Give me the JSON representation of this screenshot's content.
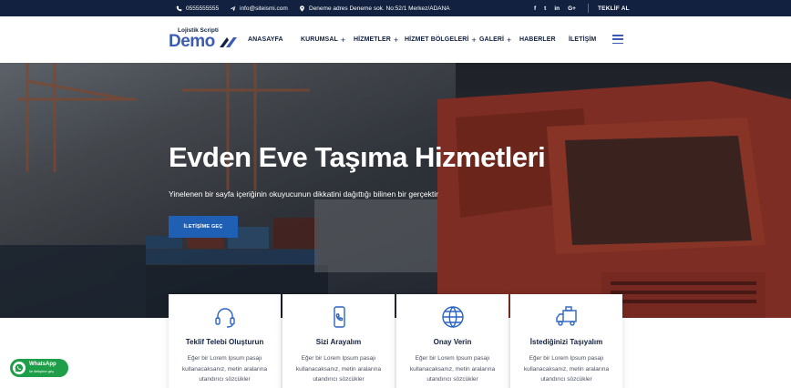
{
  "topbar": {
    "phone": "0555555555",
    "email": "info@siteismi.com",
    "address": "Deneme adres Deneme sok. No:52/1 Merkez/ADANA",
    "social": [
      "f",
      "t",
      "in",
      "G+"
    ],
    "quote_label": "TEKLİF AL"
  },
  "header": {
    "logo_sub": "Lojistik Scripti",
    "logo_main": "Demo",
    "nav": [
      {
        "label": "ANASAYFA",
        "has_children": false
      },
      {
        "label": "KURUMSAL",
        "has_children": true
      },
      {
        "label": "HİZMETLER",
        "has_children": true
      },
      {
        "label": "HİZMET BÖLGELERİ",
        "has_children": true
      },
      {
        "label": "GALERİ",
        "has_children": true
      },
      {
        "label": "HABERLER",
        "has_children": false
      },
      {
        "label": "İLETİŞİM",
        "has_children": false
      }
    ],
    "plus_symbol": "+"
  },
  "hero": {
    "title": "Evden Eve Taşıma Hizmetleri",
    "subtitle": "Yinelenen bir sayfa içeriğinin okuyucunun dikkatini dağıttığı bilinen bir gerçektir",
    "button_label": "İLETİŞİME GEÇ"
  },
  "cards": [
    {
      "icon": "headset-icon",
      "title": "Teklif Telebi Oluşturun",
      "text": "Eğer bir Lorem Ipsum pasajı kullanacaksanız, metin aralarına utandırıcı sözcükler"
    },
    {
      "icon": "phone-call-icon",
      "title": "Sizi Arayalım",
      "text": "Eğer bir Lorem Ipsum pasajı kullanacaksanız, metin aralarına utandırıcı sözcükler"
    },
    {
      "icon": "globe-icon",
      "title": "Onay Verin",
      "text": "Eğer bir Lorem Ipsum pasajı kullanacaksanız, metin aralarına utandırıcı sözcükler"
    },
    {
      "icon": "truck-icon",
      "title": "İstediğinizi Taşıyalım",
      "text": "Eğer bir Lorem Ipsum pasajı kullanacaksanız, metin aralarına utandırıcı sözcükler"
    }
  ],
  "whatsapp": {
    "title": "WhatsApp",
    "subtitle": "ile iletişime geç"
  },
  "colors": {
    "topbar_bg": "#12213f",
    "accent": "#1f5fb4",
    "logo_blue": "#3b5bb5",
    "whatsapp_green": "#1e9e48"
  }
}
